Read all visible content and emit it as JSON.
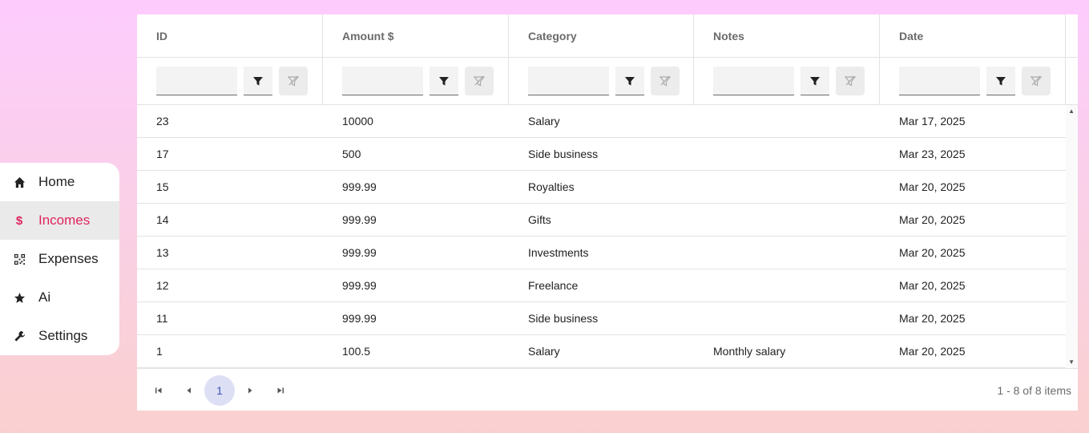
{
  "sidebar": {
    "items": [
      {
        "label": "Home",
        "icon": "home-icon"
      },
      {
        "label": "Incomes",
        "icon": "dollar-icon",
        "active": true
      },
      {
        "label": "Expenses",
        "icon": "qr-code-icon"
      },
      {
        "label": "Ai",
        "icon": "star-icon"
      },
      {
        "label": "Settings",
        "icon": "wrench-icon"
      }
    ]
  },
  "grid": {
    "columns": [
      "ID",
      "Amount $",
      "Category",
      "Notes",
      "Date"
    ],
    "rows": [
      [
        "23",
        "10000",
        "Salary",
        "",
        "Mar 17, 2025"
      ],
      [
        "17",
        "500",
        "Side business",
        "",
        "Mar 23, 2025"
      ],
      [
        "15",
        "999.99",
        "Royalties",
        "",
        "Mar 20, 2025"
      ],
      [
        "14",
        "999.99",
        "Gifts",
        "",
        "Mar 20, 2025"
      ],
      [
        "13",
        "999.99",
        "Investments",
        "",
        "Mar 20, 2025"
      ],
      [
        "12",
        "999.99",
        "Freelance",
        "",
        "Mar 20, 2025"
      ],
      [
        "11",
        "999.99",
        "Side business",
        "",
        "Mar 20, 2025"
      ],
      [
        "1",
        "100.5",
        "Salary",
        "Monthly salary",
        "Mar 20, 2025"
      ]
    ],
    "filter_values": [
      "",
      "",
      "",
      "",
      ""
    ]
  },
  "pager": {
    "current_page": "1",
    "info": "1 - 8 of 8 items"
  },
  "colors": {
    "accent": "#e0245e",
    "page_active_bg": "#dde0f5",
    "page_active_text": "#3f51b5"
  }
}
